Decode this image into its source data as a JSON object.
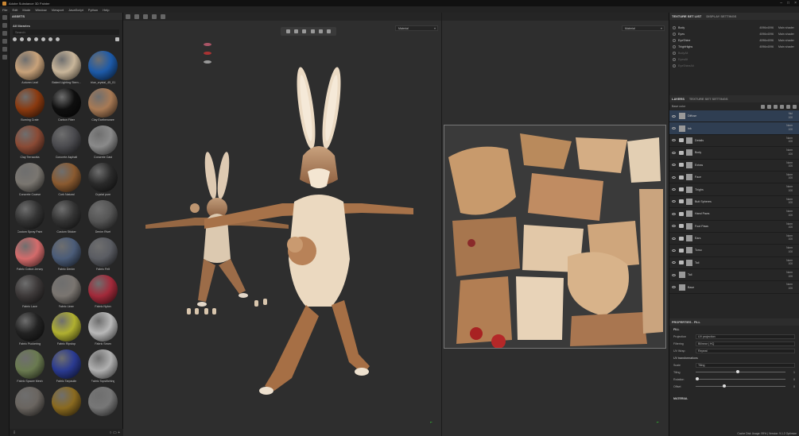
{
  "window": {
    "title": "Adobe Substance 3D Painter"
  },
  "menu": [
    "File",
    "Edit",
    "Mode",
    "Window",
    "Viewport",
    "JavaScript",
    "Python",
    "Help"
  ],
  "assets": {
    "header": "ASSETS",
    "breadcrumb": "All libraries",
    "search_placeholder": "Search",
    "items": [
      {
        "label": "Autumn Leaf",
        "icon": "autumn-leaf-icon",
        "color": "#c8a27a"
      },
      {
        "label": "Baked Lighting Stern...",
        "icon": "baked-lighting-ball",
        "color": "#c9b69a"
      },
      {
        "label": "blue_crystal_45_01",
        "icon": "blue-crystal-ball",
        "color": "#1d5aa8"
      },
      {
        "label": "Burning Crate",
        "icon": "burning-crate-ball",
        "color": "#8a3a10"
      },
      {
        "label": "Carbon Fiber",
        "icon": "carbon-fiber-ball",
        "color": "#0f0f0f"
      },
      {
        "label": "Clay Earthenware",
        "icon": "clay-earthenware-ball",
        "color": "#a87a55"
      },
      {
        "label": "Clay Terracotta",
        "icon": "clay-terracotta-ball",
        "color": "#8a4a35"
      },
      {
        "label": "Concrete Asphalt",
        "icon": "concrete-asphalt-ball",
        "color": "#4a4a4e"
      },
      {
        "label": "Concrete Cast",
        "icon": "concrete-cast-ball",
        "color": "#8a8a8a"
      },
      {
        "label": "Concrete Coarse",
        "icon": "concrete-coarse-ball",
        "color": "#7a7670"
      },
      {
        "label": "Cork Natural",
        "icon": "cork-natural-ball",
        "color": "#8a5a30"
      },
      {
        "label": "Crystal pure",
        "icon": "crystal-pure-ball",
        "color": "#2a2a2a"
      },
      {
        "label": "Custom Spray Paint",
        "icon": "spray-paint-icon",
        "color": "#333"
      },
      {
        "label": "Custom Sticker",
        "icon": "sticker-icon",
        "color": "#333"
      },
      {
        "label": "Denim Rivet",
        "icon": "denim-rivet-ball",
        "color": "#555"
      },
      {
        "label": "Fabric Cotton Jersey",
        "icon": "fabric-cotton-jersey-ball",
        "color": "#d46b6b"
      },
      {
        "label": "Fabric Denim",
        "icon": "fabric-denim-ball",
        "color": "#4b5c78"
      },
      {
        "label": "Fabric Felt",
        "icon": "fabric-felt-ball",
        "color": "#5a5c62"
      },
      {
        "label": "Fabric Lace",
        "icon": "fabric-lace-ball",
        "color": "#3c3838"
      },
      {
        "label": "Fabric Linen",
        "icon": "fabric-linen-ball",
        "color": "#7a7570"
      },
      {
        "label": "Fabric Nylon",
        "icon": "fabric-nylon-ball",
        "color": "#a22a3a"
      },
      {
        "label": "Fabric Puckering",
        "icon": "fabric-puckering-brush",
        "color": "#222"
      },
      {
        "label": "Fabric Ripstop",
        "icon": "fabric-ripstop-ball",
        "color": "#b0b030"
      },
      {
        "label": "Fabric Seam",
        "icon": "fabric-seam-ball",
        "color": "#b8b8b8"
      },
      {
        "label": "Fabric Spacer Mesh",
        "icon": "fabric-spacer-mesh-ball",
        "color": "#6a7a50"
      },
      {
        "label": "Fabric Tarpaulin",
        "icon": "fabric-tarpaulin-ball",
        "color": "#2a3a90"
      },
      {
        "label": "Fabric Topstitching",
        "icon": "fabric-topstitching-ball",
        "color": "#b0b0b0"
      },
      {
        "label": "",
        "icon": "material-ball",
        "color": "#6a6560"
      },
      {
        "label": "",
        "icon": "material-ball",
        "color": "#8a6a20"
      },
      {
        "label": "",
        "icon": "material-ball",
        "color": "#777"
      }
    ]
  },
  "viewport3d": {
    "mode": "Material"
  },
  "viewport2d": {
    "mode": "Material"
  },
  "texture_sets": {
    "tabs": [
      "TEXTURE SET LIST",
      "DISPLAY SETTINGS"
    ],
    "rows": [
      {
        "name": "Body",
        "res": "4096x4096",
        "shader": "Main shader",
        "dim": false
      },
      {
        "name": "Eyes",
        "res": "4096x4096",
        "shader": "Main shader",
        "dim": false
      },
      {
        "name": "EyeShine",
        "res": "4096x4096",
        "shader": "Main shader",
        "dim": false
      },
      {
        "name": "ThighHighs",
        "res": "4096x4096",
        "shader": "Main shader",
        "dim": false
      },
      {
        "name": "BodyAlt",
        "res": "",
        "shader": "",
        "dim": true
      },
      {
        "name": "EyesAlt",
        "res": "",
        "shader": "",
        "dim": true
      },
      {
        "name": "EyeShineAlt",
        "res": "",
        "shader": "",
        "dim": true
      }
    ]
  },
  "layers": {
    "tabs": [
      "LAYERS",
      "TEXTURE SET SETTINGS"
    ],
    "base_color": "Base color",
    "rows": [
      {
        "name": "Diffuse",
        "blend": "Mul",
        "opacity": "100",
        "folder": false,
        "sel": true
      },
      {
        "name": "Ink",
        "blend": "Norm",
        "opacity": "100",
        "folder": false,
        "sel": true
      },
      {
        "name": "Details",
        "blend": "Norm",
        "opacity": "100",
        "folder": true,
        "sel": false
      },
      {
        "name": "Body",
        "blend": "Norm",
        "opacity": "100",
        "folder": true,
        "sel": false
      },
      {
        "name": "Extras",
        "blend": "Norm",
        "opacity": "100",
        "folder": true,
        "sel": false
      },
      {
        "name": "Face",
        "blend": "Norm",
        "opacity": "100",
        "folder": true,
        "sel": false
      },
      {
        "name": "Thighs",
        "blend": "Norm",
        "opacity": "100",
        "folder": true,
        "sel": false
      },
      {
        "name": "Butt Spheres",
        "blend": "Norm",
        "opacity": "100",
        "folder": true,
        "sel": false
      },
      {
        "name": "Hand Paws",
        "blend": "Norm",
        "opacity": "100",
        "folder": true,
        "sel": false
      },
      {
        "name": "Foot Paws",
        "blend": "Norm",
        "opacity": "100",
        "folder": true,
        "sel": false
      },
      {
        "name": "Ears",
        "blend": "Norm",
        "opacity": "100",
        "folder": true,
        "sel": false
      },
      {
        "name": "Torso",
        "blend": "Norm",
        "opacity": "100",
        "folder": true,
        "sel": false
      },
      {
        "name": "Tail",
        "blend": "Norm",
        "opacity": "100",
        "folder": true,
        "sel": false
      },
      {
        "name": "Tail",
        "blend": "Norm",
        "opacity": "100",
        "folder": false,
        "sel": false
      },
      {
        "name": "Base",
        "blend": "Norm",
        "opacity": "100",
        "folder": false,
        "sel": false
      }
    ]
  },
  "properties": {
    "header": "PROPERTIES - FILL",
    "section": "FILL",
    "projection": {
      "label": "Projection",
      "value": "UV projection"
    },
    "filtering": {
      "label": "Filtering",
      "value": "Bilinear | HQ"
    },
    "uvwrap": {
      "label": "UV Wrap",
      "value": "Repeat"
    },
    "uvtrans": "UV transformations",
    "scale": {
      "label": "Scale",
      "value": "Tiling"
    },
    "tiling": {
      "label": "Tiling",
      "value": "1"
    },
    "rotation": {
      "label": "Rotation",
      "value": "0"
    },
    "offset": {
      "label": "Offset",
      "value": "0"
    },
    "material": "MATERIAL"
  },
  "status": "Cache Disk Usage: 99% | Version: 9.1.2 Optimize"
}
